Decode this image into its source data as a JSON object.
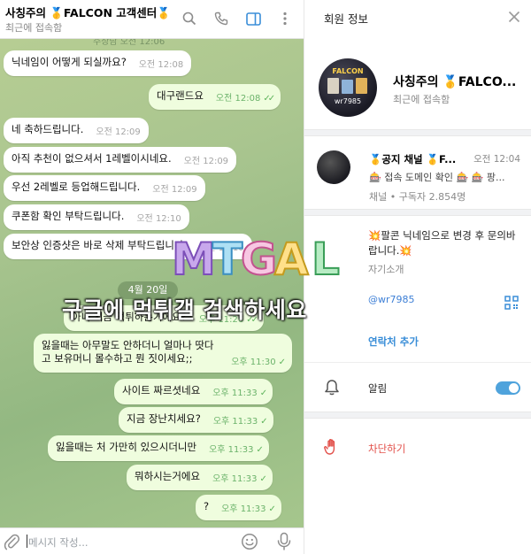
{
  "chat": {
    "title": "사칭주의 🥇FALCON 고객센터🥇",
    "status": "최근에 접속함",
    "partial_time": "주상담 오전 12:06",
    "date_chip": "4월 20일",
    "messages": [
      {
        "text": "닉네임이 어떻게 되실까요?",
        "time": "오전 12:08",
        "dir": "in"
      },
      {
        "text": "대구랜드요",
        "time": "오전 12:08",
        "dir": "out"
      },
      {
        "text": "네 축하드립니다.",
        "time": "오전 12:09",
        "dir": "in"
      },
      {
        "text": "아직 추천이 없으셔서 1레벨이시네요.",
        "time": "오전 12:09",
        "dir": "in"
      },
      {
        "text": "우선 2레벨로 등업해드립니다.",
        "time": "오전 12:09",
        "dir": "in"
      },
      {
        "text": "쿠폰함 확인 부탁드립니다.",
        "time": "오전 12:10",
        "dir": "in"
      },
      {
        "text": "보안상 인증샷은 바로 삭제 부탁드립니다.",
        "time": "오전 12:10",
        "dir": "in"
      },
      {
        "text": "아니 지금 먹튀하는거에요?",
        "time": "오후 11:26",
        "dir": "out"
      },
      {
        "text": "잃을때는 아무말도 안하더니 얼마나 땃다고 보유머니 몰수하고 뭔 짓이세요;;",
        "time": "오후 11:30",
        "dir": "out"
      },
      {
        "text": "사이트 짜르셧네요",
        "time": "오후 11:33",
        "dir": "out"
      },
      {
        "text": "지금 장난치세요?",
        "time": "오후 11:33",
        "dir": "out"
      },
      {
        "text": "잃을때는 처 가만히 있으시더니만",
        "time": "오후 11:33",
        "dir": "out"
      },
      {
        "text": "뭐하시는거에요",
        "time": "오후 11:33",
        "dir": "out"
      },
      {
        "text": "?",
        "time": "오후 11:33",
        "dir": "out"
      }
    ],
    "input_placeholder": "메시지 작성..."
  },
  "info": {
    "title": "회원 정보",
    "profile_name": "사칭주의 🥇FALCO...",
    "profile_status": "최근에 접속함",
    "avatar_label_top": "FALCON",
    "avatar_label_bottom": "wr7985",
    "channel": {
      "name": "🥇공지 채널 🥇F...",
      "time": "오전 12:04",
      "preview": "🎰 접속 도메인 확인 🎰 🎰 팡...",
      "subscribers": "채널 • 구독자 2.854명"
    },
    "bio": "💥팔콘 닉네임으로 변경 후 문의바랍니다.💥",
    "bio_label": "자기소개",
    "username": "@wr7985",
    "contact_add": "연락처 추가",
    "notifications": "알림",
    "block": "차단하기"
  },
  "watermark": {
    "logo": "MTGAL",
    "text": "구글에 먹튀갤 검색하세요"
  },
  "colors": {
    "outgoing_bubble": "#effdde",
    "incoming_bubble": "#ffffff",
    "accent": "#3a8ed8",
    "danger": "#e2504a"
  }
}
